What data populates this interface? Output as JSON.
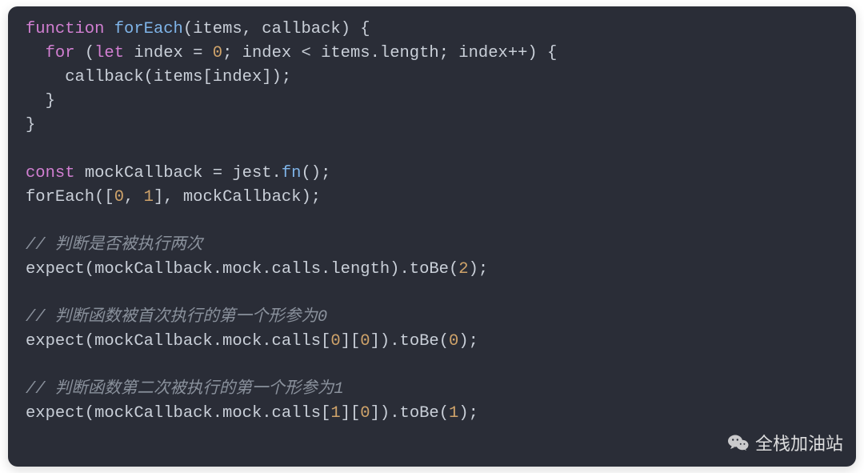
{
  "code": {
    "tokens": [
      [
        [
          "keyword",
          "function"
        ],
        [
          "plain",
          " "
        ],
        [
          "funcname",
          "forEach"
        ],
        [
          "plain",
          "(items, callback) {"
        ]
      ],
      [
        [
          "plain",
          "  "
        ],
        [
          "keyword",
          "for"
        ],
        [
          "plain",
          " ("
        ],
        [
          "keyword2",
          "let"
        ],
        [
          "plain",
          " index = "
        ],
        [
          "number",
          "0"
        ],
        [
          "plain",
          "; index < items.length; index++) {"
        ]
      ],
      [
        [
          "plain",
          "    callback(items[index]);"
        ]
      ],
      [
        [
          "plain",
          "  }"
        ]
      ],
      [
        [
          "plain",
          "}"
        ]
      ],
      [],
      [
        [
          "keyword2",
          "const"
        ],
        [
          "plain",
          " mockCallback = jest."
        ],
        [
          "fn",
          "fn"
        ],
        [
          "plain",
          "();"
        ]
      ],
      [
        [
          "plain",
          "forEach(["
        ],
        [
          "number",
          "0"
        ],
        [
          "plain",
          ", "
        ],
        [
          "number",
          "1"
        ],
        [
          "plain",
          "], mockCallback);"
        ]
      ],
      [],
      [
        [
          "comment",
          "// 判断是否被执行两次"
        ]
      ],
      [
        [
          "plain",
          "expect(mockCallback.mock.calls.length).toBe("
        ],
        [
          "number",
          "2"
        ],
        [
          "plain",
          ");"
        ]
      ],
      [],
      [
        [
          "comment",
          "// 判断函数被首次执行的第一个形参为0"
        ]
      ],
      [
        [
          "plain",
          "expect(mockCallback.mock.calls["
        ],
        [
          "number",
          "0"
        ],
        [
          "plain",
          "]["
        ],
        [
          "number",
          "0"
        ],
        [
          "plain",
          "]).toBe("
        ],
        [
          "number",
          "0"
        ],
        [
          "plain",
          ");"
        ]
      ],
      [],
      [
        [
          "comment",
          "// 判断函数第二次被执行的第一个形参为1"
        ]
      ],
      [
        [
          "plain",
          "expect(mockCallback.mock.calls["
        ],
        [
          "number",
          "1"
        ],
        [
          "plain",
          "]["
        ],
        [
          "number",
          "0"
        ],
        [
          "plain",
          "]).toBe("
        ],
        [
          "number",
          "1"
        ],
        [
          "plain",
          ");"
        ]
      ]
    ]
  },
  "watermark": {
    "text": "全栈加油站"
  }
}
